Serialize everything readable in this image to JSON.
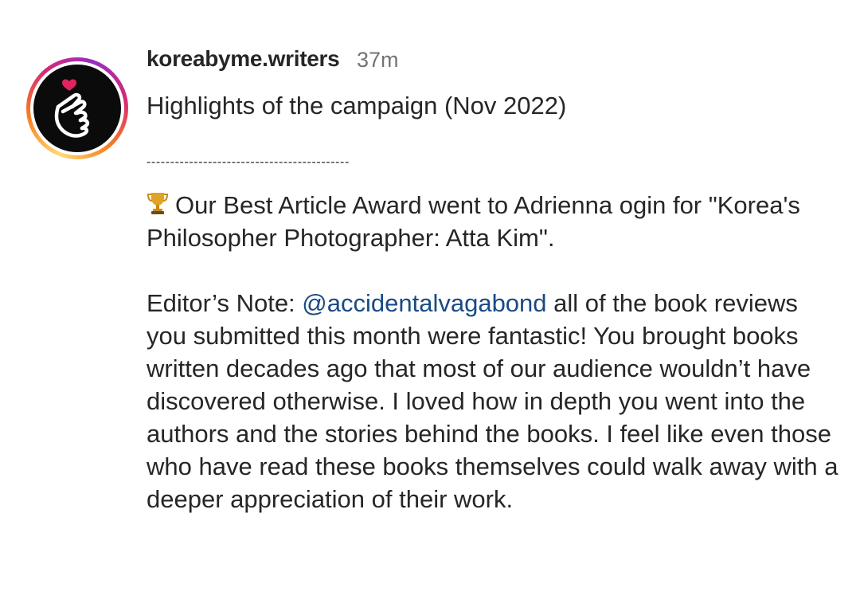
{
  "post": {
    "username": "koreabyme.writers",
    "time_ago": "37m",
    "title": "Highlights of the campaign (Nov 2022)",
    "divider": "-------------------------------------------",
    "award_text": "Our Best Article Award went to Adrienna ogin for \"Korea's Philosopher Photographer: Atta Kim\".",
    "editor_prefix": "Editor’s Note: ",
    "mention": "@accidentalvagabond",
    "editor_body": " all of the book reviews you submitted this month were fantastic! You brought books written decades ago that most of our audience wouldn’t have discovered otherwise. I loved how in depth you went into the authors and the stories behind the books. I feel like even those who have read these books themselves could walk away with a deeper appreciation of their work."
  },
  "icons": {
    "avatar": "finger-heart-icon",
    "award": "trophy-icon"
  },
  "colors": {
    "text": "#262626",
    "muted": "#737373",
    "mention": "#1a4a85",
    "story_ring": [
      "#feda75",
      "#fa7e1e",
      "#d62976",
      "#962fbf"
    ],
    "heart": "#e0245e"
  }
}
